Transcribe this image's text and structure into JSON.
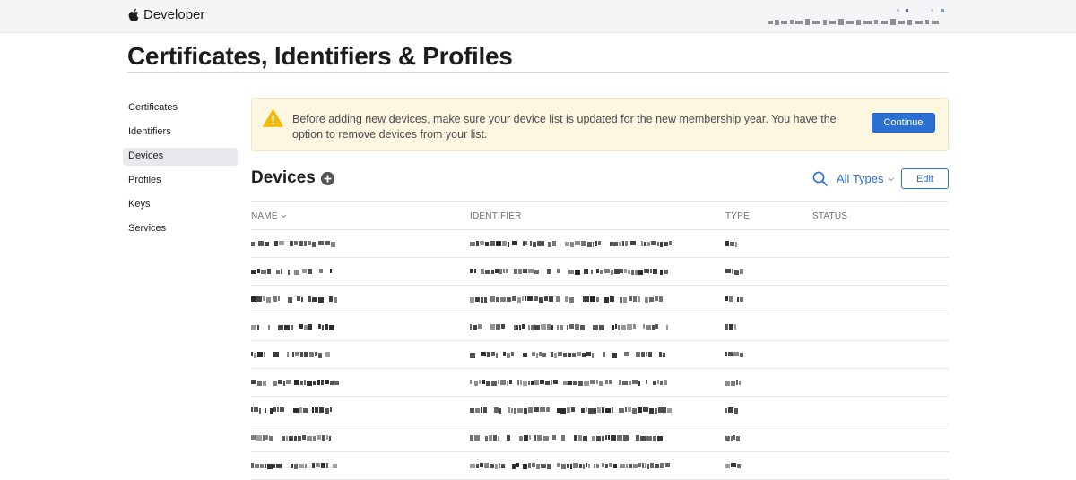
{
  "nav": {
    "brand": "Developer"
  },
  "page": {
    "title": "Certificates, Identifiers & Profiles"
  },
  "sidebar": {
    "items": [
      {
        "label": "Certificates",
        "active": false
      },
      {
        "label": "Identifiers",
        "active": false
      },
      {
        "label": "Devices",
        "active": true
      },
      {
        "label": "Profiles",
        "active": false
      },
      {
        "label": "Keys",
        "active": false
      },
      {
        "label": "Services",
        "active": false
      }
    ]
  },
  "notice": {
    "icon": "warning-triangle-icon",
    "text": "Before adding new devices, make sure your device list is updated for the new membership year. You have the option to remove devices from your list.",
    "button_label": "Continue"
  },
  "devices": {
    "title": "Devices",
    "filter_label": "All Types",
    "edit_label": "Edit",
    "columns": [
      "NAME",
      "IDENTIFIER",
      "TYPE",
      "STATUS"
    ],
    "sort_column": "NAME",
    "row_count_visible": 9
  },
  "colors": {
    "accent": "#2b6fd0",
    "banner_bg": "#fdf6e0",
    "warning": "#f5b800",
    "active_item_bg": "#e8e8ed"
  }
}
